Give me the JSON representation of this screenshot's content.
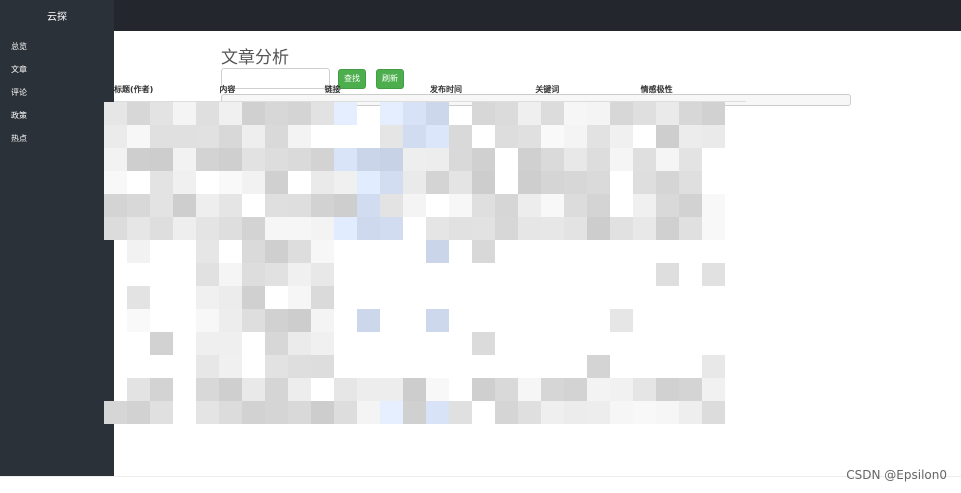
{
  "app": {
    "brand": "云探"
  },
  "sidebar": {
    "items": [
      {
        "label": "总览"
      },
      {
        "label": "文章"
      },
      {
        "label": "评论"
      },
      {
        "label": "政策"
      },
      {
        "label": "热点"
      }
    ]
  },
  "main": {
    "title": "文章分析",
    "search": {
      "value": "",
      "placeholder": ""
    },
    "buttons": {
      "find": "查找",
      "refresh": "刷新"
    },
    "table": {
      "columns": [
        "标题(作者)",
        "内容",
        "链接",
        "发布时间",
        "关键词",
        "情感极性"
      ]
    }
  },
  "watermark": "CSDN @Epsilon0",
  "colors": {
    "topbar": "#23272d",
    "sidebar": "#2b3138",
    "button_green": "#4cae4c"
  }
}
